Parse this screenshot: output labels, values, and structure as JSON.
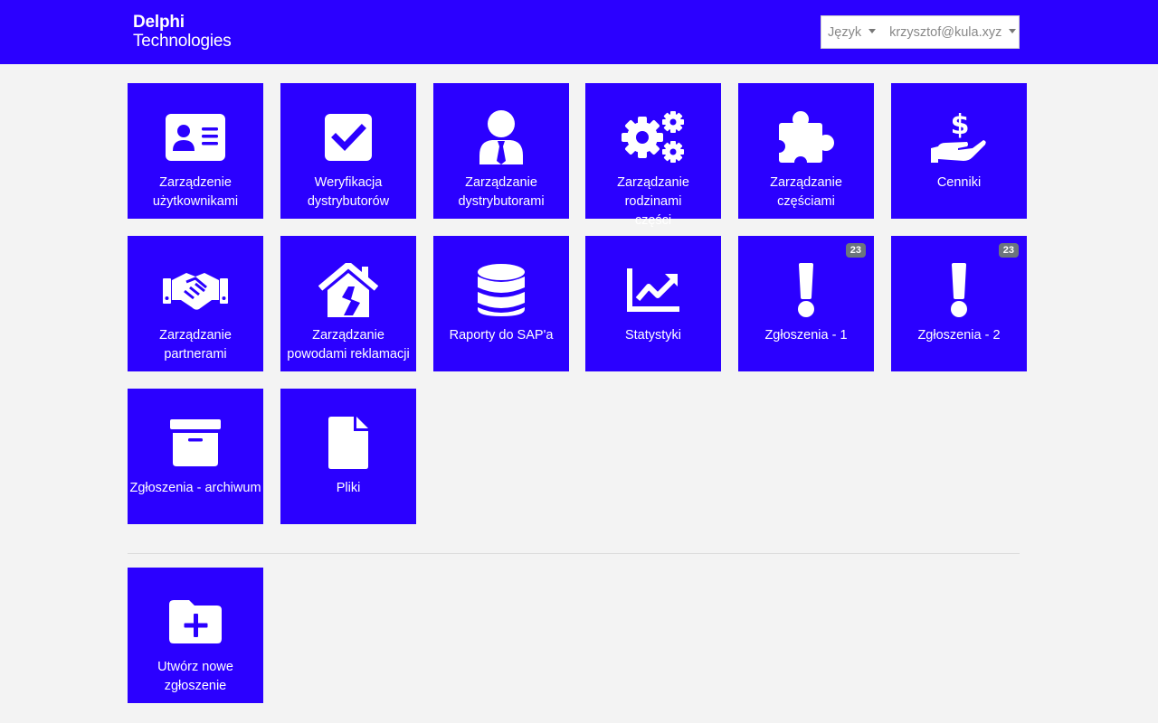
{
  "brand": {
    "line1": "Delphi",
    "line2": "Technologies"
  },
  "nav": {
    "language_label": "Język",
    "user_email": "krzysztof@kula.xyz"
  },
  "tiles": [
    {
      "lines": [
        "Zarządzenie",
        "użytkownikami"
      ],
      "icon": "id-card-icon"
    },
    {
      "lines": [
        "Weryfikacja",
        "dystrybutorów"
      ],
      "icon": "check-square-icon"
    },
    {
      "lines": [
        "Zarządzanie",
        "dystrybutorami"
      ],
      "icon": "user-tie-icon"
    },
    {
      "lines": [
        "Zarządzanie rodzinami",
        "części"
      ],
      "icon": "cogs-icon"
    },
    {
      "lines": [
        "Zarządzanie",
        "częściami"
      ],
      "icon": "puzzle-piece-icon"
    },
    {
      "lines": [
        "Cenniki"
      ],
      "icon": "hand-holding-usd-icon"
    },
    {
      "lines": [
        "Zarządzanie",
        "partnerami"
      ],
      "icon": "handshake-icon"
    },
    {
      "lines": [
        "Zarządzanie",
        "powodami reklamacji"
      ],
      "icon": "house-damage-icon"
    },
    {
      "lines": [
        "Raporty do SAP'a"
      ],
      "icon": "database-icon"
    },
    {
      "lines": [
        "Statystyki"
      ],
      "icon": "chart-line-icon"
    },
    {
      "lines": [
        "Zgłoszenia - 1"
      ],
      "icon": "exclamation-icon",
      "badge": "23"
    },
    {
      "lines": [
        "Zgłoszenia - 2"
      ],
      "icon": "exclamation-icon",
      "badge": "23"
    },
    {
      "lines": [
        "Zgłoszenia - archiwum"
      ],
      "icon": "archive-icon"
    },
    {
      "lines": [
        "Pliki"
      ],
      "icon": "file-icon"
    }
  ],
  "new_ticket": {
    "lines": [
      "Utwórz nowe",
      "zgłoszenie"
    ],
    "icon": "folder-plus-icon"
  },
  "colors": {
    "primary": "#2b00ff",
    "background": "#f3f3f3",
    "badge": "#6c757d"
  }
}
